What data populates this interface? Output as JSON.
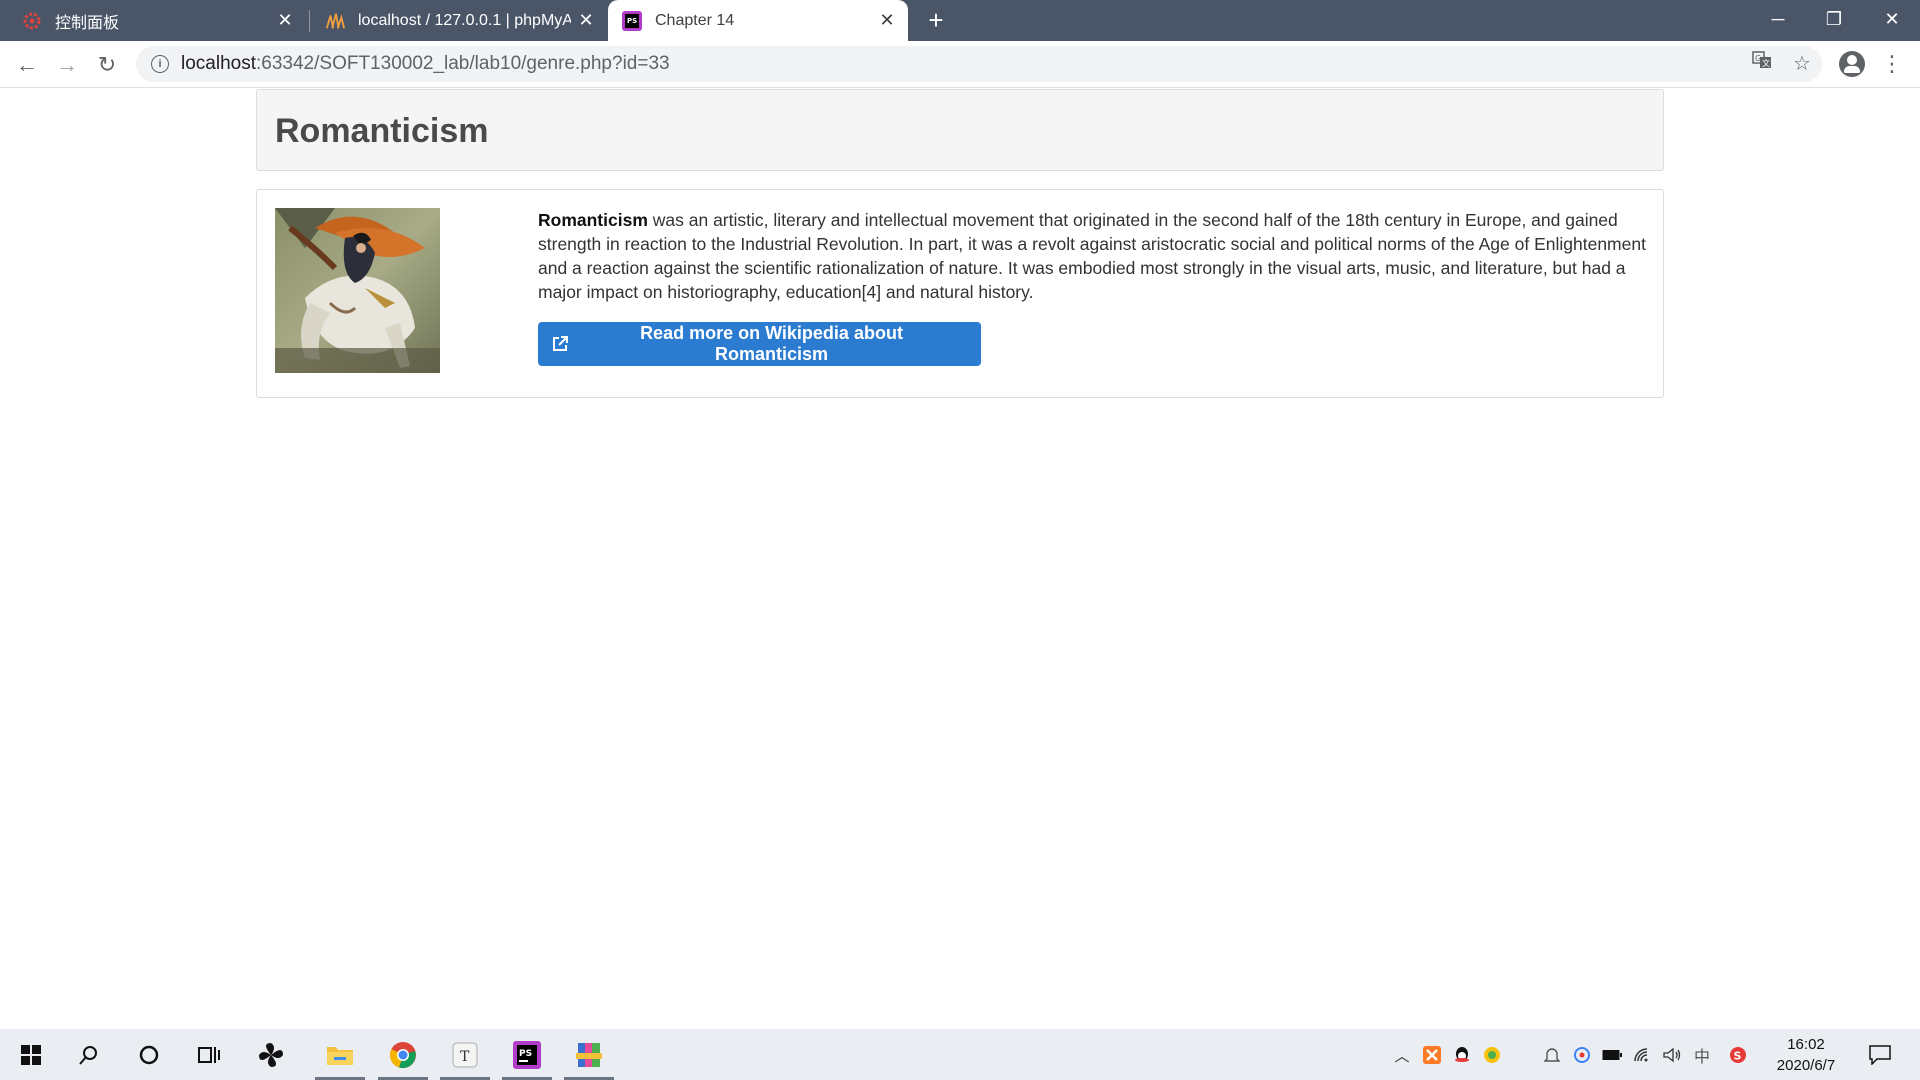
{
  "browser": {
    "tabs": [
      {
        "title": "控制面板",
        "icon": "control-panel-icon",
        "active": false
      },
      {
        "title": "localhost / 127.0.0.1 | phpMyA",
        "icon": "phpmyadmin-icon",
        "active": false
      },
      {
        "title": "Chapter 14",
        "icon": "phpstorm-icon",
        "active": true
      }
    ],
    "new_tab_label": "+",
    "url_host": "localhost",
    "url_rest": ":63342/SOFT130002_lab/lab10/genre.php?id=33"
  },
  "page": {
    "genre_title": "Romanticism",
    "description_lead": "Romanticism",
    "description_body": " was an artistic, literary and intellectual movement that originated in the second half of the 18th century in Europe, and gained strength in reaction to the Industrial Revolution. In part, it was a revolt against aristocratic social and political norms of the Age of Enlightenment and a reaction against the scientific rationalization of nature. It was embodied most strongly in the visual arts, music, and literature, but had a major impact on historiography, education[4] and natural history.",
    "wiki_button_label": "Read more on Wikipedia about Romanticism"
  },
  "taskbar": {
    "time": "16:02",
    "date": "2020/6/7",
    "ime_label": "中"
  },
  "colors": {
    "tabstrip": "#4a5568",
    "button_blue": "#2b7bd1",
    "header_panel": "#f5f5f5"
  }
}
